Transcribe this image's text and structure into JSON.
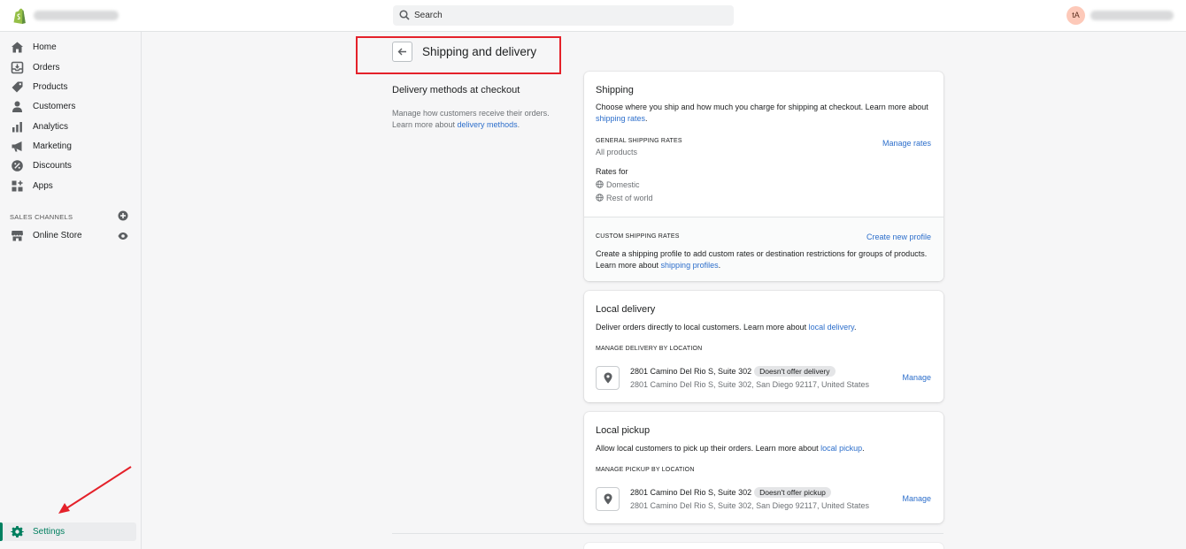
{
  "topbar": {
    "search_placeholder": "Search",
    "avatar_initials": "tA"
  },
  "sidebar": {
    "items": [
      {
        "label": "Home",
        "icon": "home-icon"
      },
      {
        "label": "Orders",
        "icon": "orders-icon"
      },
      {
        "label": "Products",
        "icon": "tag-icon"
      },
      {
        "label": "Customers",
        "icon": "person-icon"
      },
      {
        "label": "Analytics",
        "icon": "bar-chart-icon"
      },
      {
        "label": "Marketing",
        "icon": "megaphone-icon"
      },
      {
        "label": "Discounts",
        "icon": "discount-icon"
      },
      {
        "label": "Apps",
        "icon": "apps-icon"
      }
    ],
    "sales_channels_label": "SALES CHANNELS",
    "online_store_label": "Online Store",
    "settings_label": "Settings"
  },
  "header": {
    "title": "Shipping and delivery"
  },
  "left": {
    "title": "Delivery methods at checkout",
    "text_1": "Manage how customers receive their orders.",
    "text_2": "Learn more about ",
    "link": "delivery methods",
    "text_end": "."
  },
  "shipping": {
    "title": "Shipping",
    "desc": "Choose where you ship and how much you charge for shipping at checkout. Learn more about ",
    "desc_link": "shipping rates",
    "desc_end": ".",
    "general_caption": "GENERAL SHIPPING RATES",
    "all_products": "All products",
    "manage_rates": "Manage rates",
    "rates_for": "Rates for",
    "zones": [
      "Domestic",
      "Rest of world"
    ],
    "custom_caption": "CUSTOM SHIPPING RATES",
    "create_profile": "Create new profile",
    "custom_desc": "Create a shipping profile to add custom rates or destination restrictions for groups of products. Learn more about ",
    "custom_link": "shipping profiles",
    "custom_end": "."
  },
  "local_delivery": {
    "title": "Local delivery",
    "desc": "Deliver orders directly to local customers. Learn more about ",
    "desc_link": "local delivery",
    "desc_end": ".",
    "caption": "MANAGE DELIVERY BY LOCATION",
    "location_name": "2801 Camino Del Rio S, Suite 302",
    "badge": "Doesn't offer delivery",
    "address": "2801 Camino Del Rio S, Suite 302, San Diego 92117, United States",
    "manage": "Manage"
  },
  "local_pickup": {
    "title": "Local pickup",
    "desc": "Allow local customers to pick up their orders. Learn more about ",
    "desc_link": "local pickup",
    "desc_end": ".",
    "caption": "MANAGE PICKUP BY LOCATION",
    "location_name": "2801 Camino Del Rio S, Suite 302",
    "badge": "Doesn't offer pickup",
    "address": "2801 Camino Del Rio S, Suite 302, San Diego 92117, United States",
    "manage": "Manage"
  },
  "colors": {
    "accent_green": "#008060",
    "link_blue": "#2c6ecb",
    "highlight_red": "#e4212a"
  }
}
